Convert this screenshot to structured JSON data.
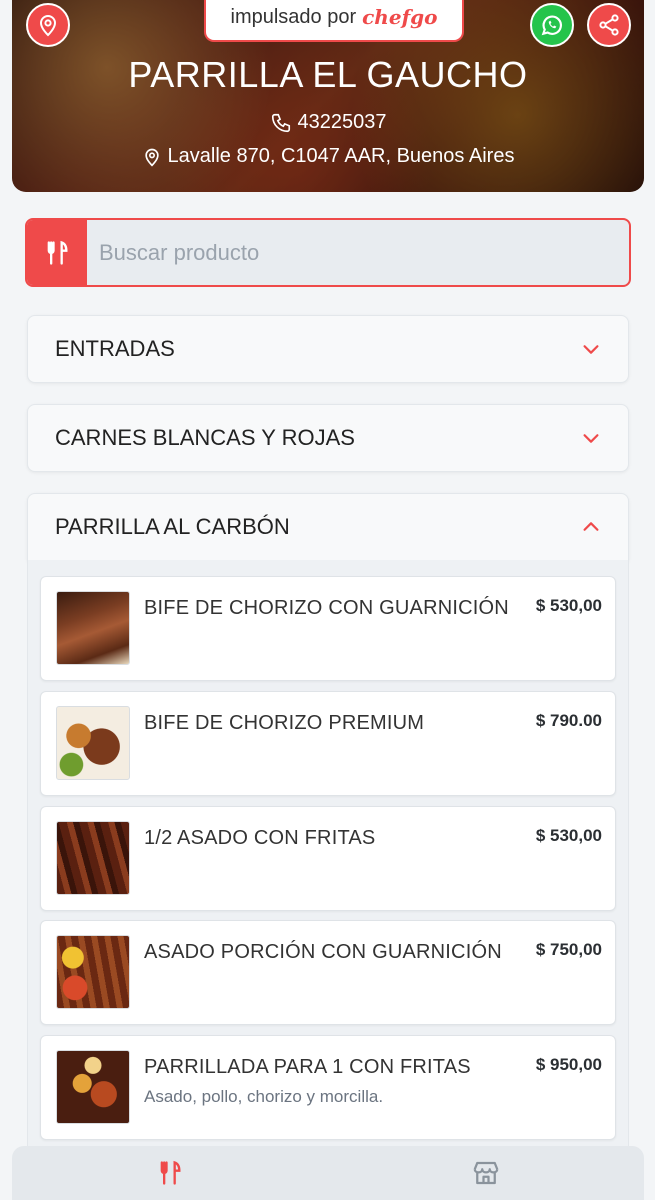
{
  "header": {
    "powered_prefix": "impulsado por",
    "powered_brand": "chefgo",
    "restaurant_name": "PARRILLA EL GAUCHO",
    "phone": "43225037",
    "address": "Lavalle 870, C1047 AAR, Buenos Aires",
    "accent_color": "#ef4a4a",
    "whatsapp_color": "#25c44b"
  },
  "search": {
    "placeholder": "Buscar producto",
    "value": ""
  },
  "categories": [
    {
      "label": "ENTRADAS",
      "expanded": false
    },
    {
      "label": "CARNES BLANCAS Y ROJAS",
      "expanded": false
    },
    {
      "label": "PARRILLA AL CARBÓN",
      "expanded": true
    }
  ],
  "products": [
    {
      "name": "BIFE DE CHORIZO CON GUARNICIÓN",
      "price": "$ 530,00",
      "description": ""
    },
    {
      "name": "BIFE DE CHORIZO PREMIUM",
      "price": "$ 790.00",
      "description": ""
    },
    {
      "name": "1/2 ASADO CON FRITAS",
      "price": "$ 530,00",
      "description": ""
    },
    {
      "name": "ASADO PORCIÓN CON GUARNICIÓN",
      "price": "$ 750,00",
      "description": ""
    },
    {
      "name": "PARRILLADA PARA 1 CON FRITAS",
      "price": "$ 950,00",
      "description": "Asado, pollo, chorizo y morcilla."
    }
  ],
  "bottom_nav": [
    {
      "icon": "fork-knife-icon",
      "active": true
    },
    {
      "icon": "store-icon",
      "active": false
    }
  ]
}
